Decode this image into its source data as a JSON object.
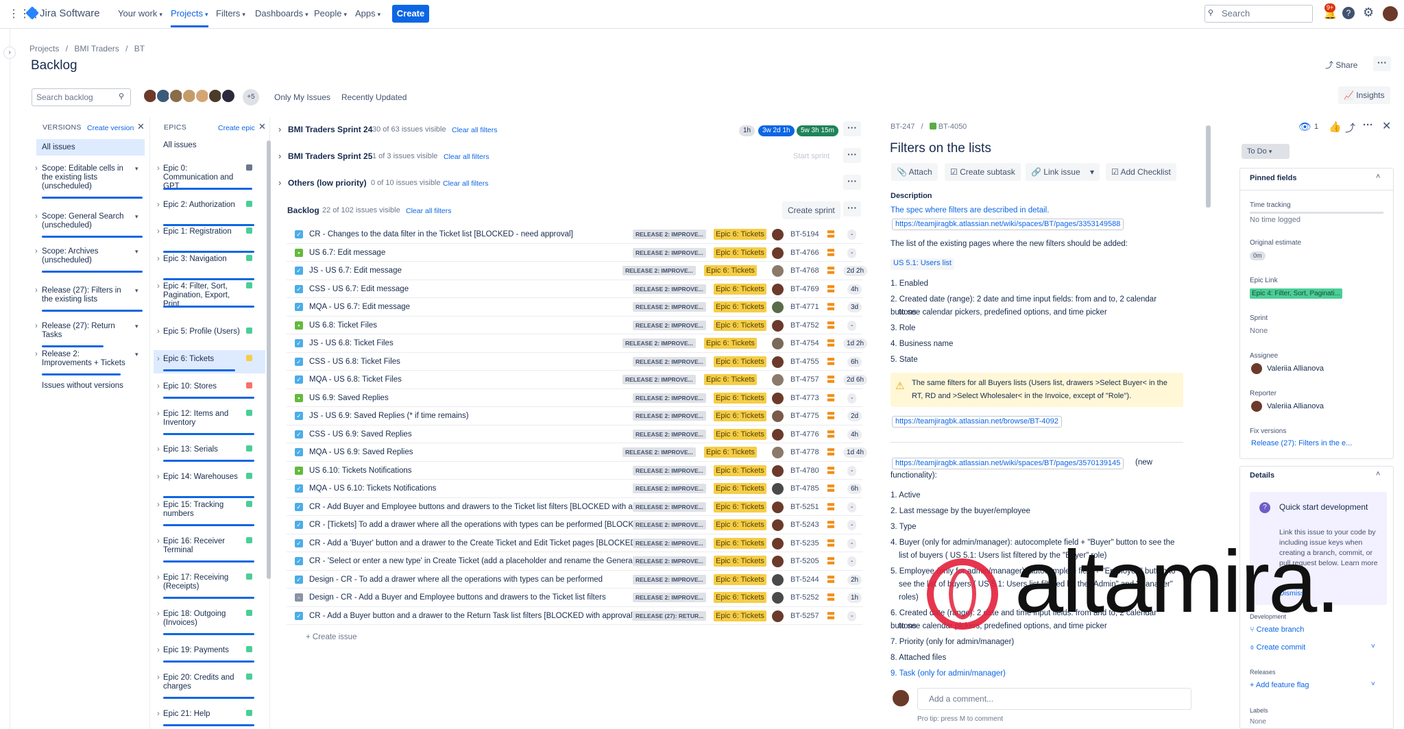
{
  "app": {
    "product": "Jira Software"
  },
  "nav": {
    "your_work": "Your work",
    "projects": "Projects",
    "filters": "Filters",
    "dashboards": "Dashboards",
    "people": "People",
    "apps": "Apps",
    "create": "Create",
    "search_placeholder": "Search",
    "notif_count": "9+"
  },
  "breadcrumb": {
    "projects": "Projects",
    "project": "BMI Traders",
    "key": "BT"
  },
  "page": {
    "title": "Backlog",
    "share": "Share",
    "insights": "Insights",
    "search_placeholder": "Search backlog",
    "avatar_more": "+5",
    "only_my": "Only My Issues",
    "recently": "Recently Updated"
  },
  "versions": {
    "header": "VERSIONS",
    "create": "Create version",
    "all": "All issues",
    "without": "Issues without versions",
    "items": [
      "Scope: Editable cells in the existing lists (unscheduled)",
      "Scope: General Search (unscheduled)",
      "Scope: Archives (unscheduled)",
      "Release (27): Filters in the existing lists",
      "Release (27): Return Tasks",
      "Release 2: Improvements + Tickets"
    ]
  },
  "epics": {
    "header": "EPICS",
    "create": "Create epic",
    "all": "All issues",
    "items": [
      "Epic 0: Communication and GPT",
      "Epic 2: Authorization",
      "Epic 1: Registration",
      "Epic 3: Navigation",
      "Epic 4: Filter, Sort, Pagination, Export, Print",
      "Epic 5: Profile (Users)",
      "Epic 6: Tickets",
      "Epic 10: Stores",
      "Epic 12: Items and Inventory",
      "Epic 13: Serials",
      "Epic 14: Warehouses",
      "Epic 15: Tracking numbers",
      "Epic 16: Receiver Terminal",
      "Epic 17: Receiving (Receipts)",
      "Epic 18: Outgoing (Invoices)",
      "Epic 19: Payments",
      "Epic 20: Credits and charges",
      "Epic 21: Help"
    ]
  },
  "sprints": [
    {
      "name": "BMI Traders Sprint 24",
      "count": "30 of 63 issues visible",
      "clear": "Clear all filters",
      "est1": "1h",
      "est2": "3w 2d 1h",
      "est3": "5w 3h 15m"
    },
    {
      "name": "BMI Traders Sprint 25",
      "count": "1 of 3 issues visible",
      "clear": "Clear all filters",
      "action": "Start sprint"
    },
    {
      "name": "Others (low priority)",
      "count": "0 of 10 issues visible",
      "clear": "Clear all filters"
    }
  ],
  "backlog": {
    "name": "Backlog",
    "count": "22 of 102 issues visible",
    "clear": "Clear all filters",
    "create_sprint": "Create sprint",
    "create_issue": "+ Create issue"
  },
  "issues": [
    {
      "type": "task",
      "summary": "CR - Changes to the data filter in the Ticket list [BLOCKED - need approval]",
      "version": "RELEASE 2: IMPROVE...",
      "epic": "Epic 6: Tickets",
      "key": "BT-5194",
      "est": "-"
    },
    {
      "type": "story",
      "summary": "US 6.7: Edit message",
      "version": "RELEASE 2: IMPROVE...",
      "epic": "Epic 6: Tickets",
      "key": "BT-4766",
      "est": "-"
    },
    {
      "type": "task",
      "summary": "JS - US 6.7: Edit message",
      "version": "RELEASE 2: IMPROVE...",
      "epic": "Epic 6: Tickets",
      "key": "BT-4768",
      "est": "2d 2h"
    },
    {
      "type": "task",
      "summary": "CSS - US 6.7: Edit message",
      "version": "RELEASE 2: IMPROVE...",
      "epic": "Epic 6: Tickets",
      "key": "BT-4769",
      "est": "4h"
    },
    {
      "type": "task",
      "summary": "MQA - US 6.7: Edit message",
      "version": "RELEASE 2: IMPROVE...",
      "epic": "Epic 6: Tickets",
      "key": "BT-4771",
      "est": "3d"
    },
    {
      "type": "story",
      "summary": "US 6.8: Ticket Files",
      "version": "RELEASE 2: IMPROVE...",
      "epic": "Epic 6: Tickets",
      "key": "BT-4752",
      "est": "-"
    },
    {
      "type": "task",
      "summary": "JS - US 6.8: Ticket Files",
      "version": "RELEASE 2: IMPROVE...",
      "epic": "Epic 6: Tickets",
      "key": "BT-4754",
      "est": "1d 2h"
    },
    {
      "type": "task",
      "summary": "CSS - US 6.8: Ticket Files",
      "version": "RELEASE 2: IMPROVE...",
      "epic": "Epic 6: Tickets",
      "key": "BT-4755",
      "est": "6h"
    },
    {
      "type": "task",
      "summary": "MQA - US 6.8: Ticket Files",
      "version": "RELEASE 2: IMPROVE...",
      "epic": "Epic 6: Tickets",
      "key": "BT-4757",
      "est": "2d 6h"
    },
    {
      "type": "story",
      "summary": "US 6.9: Saved Replies",
      "version": "RELEASE 2: IMPROVE...",
      "epic": "Epic 6: Tickets",
      "key": "BT-4773",
      "est": "-"
    },
    {
      "type": "task",
      "summary": "JS - US 6.9: Saved Replies (* if time remains)",
      "version": "RELEASE 2: IMPROVE...",
      "epic": "Epic 6: Tickets",
      "key": "BT-4775",
      "est": "2d"
    },
    {
      "type": "task",
      "summary": "CSS - US 6.9: Saved Replies",
      "version": "RELEASE 2: IMPROVE...",
      "epic": "Epic 6: Tickets",
      "key": "BT-4776",
      "est": "4h"
    },
    {
      "type": "task",
      "summary": "MQA - US 6.9: Saved Replies",
      "version": "RELEASE 2: IMPROVE...",
      "epic": "Epic 6: Tickets",
      "key": "BT-4778",
      "est": "1d 4h"
    },
    {
      "type": "story",
      "summary": "US 6.10: Tickets Notifications",
      "version": "RELEASE 2: IMPROVE...",
      "epic": "Epic 6: Tickets",
      "key": "BT-4780",
      "est": "-"
    },
    {
      "type": "task",
      "summary": "MQA - US 6.10: Tickets Notifications",
      "version": "RELEASE 2: IMPROVE...",
      "epic": "Epic 6: Tickets",
      "key": "BT-4785",
      "est": "6h"
    },
    {
      "type": "task",
      "summary": "CR - Add Buyer and Employee buttons and drawers to the Ticket list filters [BLOCKED with ap",
      "version": "RELEASE 2: IMPROVE...",
      "epic": "Epic 6: Tickets",
      "key": "BT-5251",
      "est": "-"
    },
    {
      "type": "task",
      "summary": "CR - [Tickets] To add a drawer where all the operations with types can be performed [BLOCKE",
      "version": "RELEASE 2: IMPROVE...",
      "epic": "Epic 6: Tickets",
      "key": "BT-5243",
      "est": "-"
    },
    {
      "type": "task",
      "summary": "CR - Add a 'Buyer' button and a drawer to the Create Ticket and Edit Ticket pages [BLOCKED v",
      "version": "RELEASE 2: IMPROVE...",
      "epic": "Epic 6: Tickets",
      "key": "BT-5235",
      "est": "-"
    },
    {
      "type": "task",
      "summary": "CR - 'Select or enter a new type' in Create Ticket (add a placeholder and rename the General t",
      "version": "RELEASE 2: IMPROVE...",
      "epic": "Epic 6: Tickets",
      "key": "BT-5205",
      "est": "-"
    },
    {
      "type": "task",
      "summary": "Design - CR - To add a drawer where all the operations with types can be performed",
      "version": "RELEASE 2: IMPROVE...",
      "epic": "Epic 6: Tickets",
      "key": "BT-5244",
      "est": "2h"
    },
    {
      "type": "subtask",
      "summary": "Design - CR - Add a Buyer and Employee buttons and drawers to the Ticket list filters",
      "version": "RELEASE 2: IMPROVE...",
      "epic": "Epic 6: Tickets",
      "key": "BT-5252",
      "est": "1h"
    },
    {
      "type": "task",
      "summary": "CR - Add a Buyer button and a drawer to the Return Task list filters [BLOCKED with approval]",
      "version": "RELEASE (27): RETUR...",
      "epic": "Epic 6: Tickets",
      "key": "BT-5257",
      "est": "-"
    }
  ],
  "detail": {
    "parent": "BT-247",
    "key": "BT-4050",
    "title": "Filters on the lists",
    "attach": "Attach",
    "subtask": "Create subtask",
    "link": "Link issue",
    "checklist": "Add Checklist",
    "desc_label": "Description",
    "spec_line": "The spec where filters are described in detail.",
    "url1": "https://teamjiragbk.atlassian.net/wiki/spaces/BT/pages/3353149588",
    "list_line": "The list of the existing pages where the new filters should be added:",
    "us51": "US 5.1: Users list",
    "list1": [
      "1. Enabled",
      "2. Created date (range): 2 date and time input fields: from and to, 2 calendar buttons",
      "to see calendar pickers, predefined options, and time picker",
      "3. Role",
      "4. Business name",
      "5. State"
    ],
    "warn": "The same filters for all Buyers lists (Users list, drawers >Select Buyer< in the RT, RD and >Select Wholesaler< in the Invoice, except of \"Role\").",
    "url2": "https://teamjiragbk.atlassian.net/browse/BT-4092",
    "url3": "https://teamjiragbk.atlassian.net/wiki/spaces/BT/pages/3570139145",
    "url3_suffix": "(new functionality):",
    "list2": [
      "1. Active",
      "2. Last message by the buyer/employee",
      "3. Type",
      "4. Buyer (only for admin/manager): autocomplete field + \"Buyer\" button to see the",
      "list of buyers ( US 5.1: Users list filtered by the \"Buyer\" role)",
      "5. Employee (only for admin/manager): autocomplete field + \"Employee\" button to",
      "see the list of buyers ( US 5.1: Users list filtered by the \"Admin\" and \"Manager\"",
      "roles)",
      "6. Created date (range): 2 date and time input fields: from and to, 2 calendar buttons",
      "to see calendar pickers, predefined options, and time picker",
      "7. Priority (only for admin/manager)",
      "8. Attached files",
      "9. Task (only for admin/manager)"
    ],
    "comment_placeholder": "Add a comment...",
    "protip": "Pro tip: press M to comment",
    "status": "To Do",
    "watchers": "1",
    "pinned": "Pinned fields",
    "time_tracking": "Time tracking",
    "no_time": "No time logged",
    "orig_est": "Original estimate",
    "orig_est_val": "0m",
    "epic_link": "Epic Link",
    "epic_link_val": "Epic 4: Filter, Sort, Paginati...",
    "sprint": "Sprint",
    "sprint_val": "None",
    "assignee": "Assignee",
    "assignee_val": "Valeriia Allianova",
    "reporter": "Reporter",
    "reporter_val": "Valeriia Allianova",
    "fix": "Fix versions",
    "fix_val": "Release (27): Filters in the e...",
    "details": "Details",
    "qs_title": "Quick start development",
    "qs_body": "Link this issue to your code by including issue keys when creating a branch, commit, or pull request below. Learn more",
    "qs_dismiss": "Dismiss",
    "development": "Development",
    "create_branch": "Create branch",
    "create_commit": "Create commit",
    "releases": "Releases",
    "add_flag": "Add feature flag",
    "labels": "Labels",
    "labels_val": "None"
  },
  "watermark": "altamira."
}
